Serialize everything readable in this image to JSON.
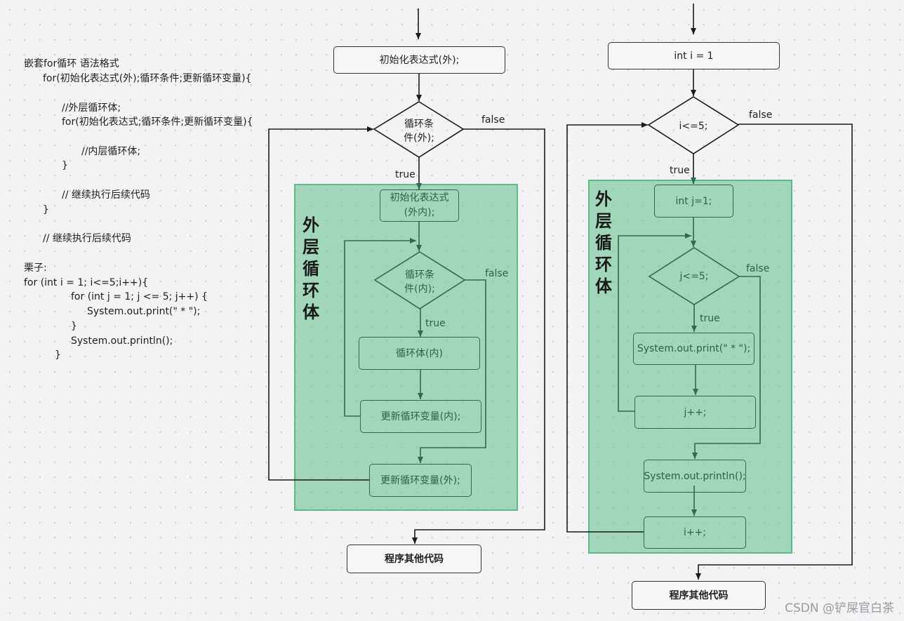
{
  "code_panel": {
    "lines": [
      "嵌套for循环 语法格式",
      "for(初始化表达式(外);循环条件;更新循环变量){",
      "//外层循环体;",
      "for(初始化表达式;循环条件;更新循环变量){",
      "//内层循环体;",
      "}",
      "// 继续执行后续代码",
      "}",
      "// 继续执行后续代码",
      "栗子:",
      "for (int i = 1; i<=5;i++){",
      "for (int j = 1; j <= 5; j++) {",
      "System.out.print(\" * \");",
      "}",
      "System.out.println();",
      "}"
    ]
  },
  "generic_flow": {
    "init_outer": "初始化表达式(外);",
    "cond_outer": "循环条件\n件(外);",
    "cond_outer_l1": "循环条",
    "cond_outer_l2": "件(外);",
    "true_label": "true",
    "false_label": "false",
    "panel_label": [
      "外",
      "层",
      "循",
      "环",
      "体"
    ],
    "init_inner_l1": "初始化表达式",
    "init_inner_l2": "(外内);",
    "cond_inner_l1": "循环条",
    "cond_inner_l2": "件(内);",
    "inner_true": "true",
    "inner_false": "false",
    "body_inner": "循环体(内)",
    "update_inner": "更新循环变量(内);",
    "update_outer": "更新循环变量(外);",
    "after": "程序其他代码"
  },
  "example_flow": {
    "init_outer": "int i = 1",
    "cond_outer": "i<=5;",
    "true_label": "true",
    "false_label": "false",
    "panel_label": [
      "外",
      "层",
      "循",
      "环",
      "体"
    ],
    "init_inner": "int j=1;",
    "cond_inner": "j<=5;",
    "inner_true": "true",
    "inner_false": "false",
    "body_inner": "System.out.print(\" * \");",
    "update_inner": "j++;",
    "println": "System.out.println();",
    "update_outer": "i++;",
    "after": "程序其他代码"
  },
  "watermark": "CSDN @铲屎官白茶",
  "colors": {
    "panel_fill": "#9dd4b8",
    "panel_border": "#5cbb86",
    "inner_line": "#2f6b4a",
    "outer_line": "#1a1a1a"
  }
}
